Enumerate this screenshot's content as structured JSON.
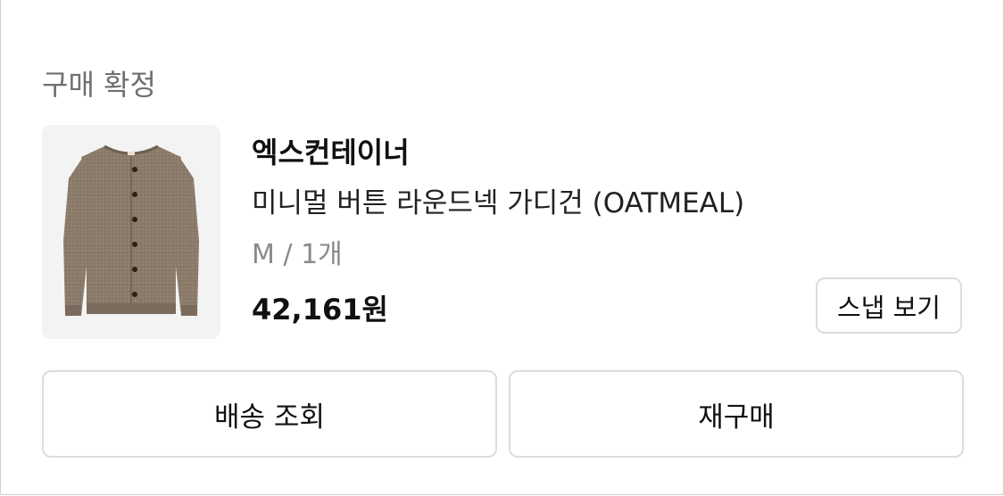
{
  "order_status": {
    "title": "구매 확정"
  },
  "product": {
    "image_icon": "cardigan-icon",
    "brand": "엑스컨테이너",
    "name": "미니멀 버튼 라운드넥 가디건 (OATMEAL)",
    "option": "M / 1개",
    "price": "42,161원"
  },
  "buttons": {
    "snap_view": "스냅 보기",
    "track_delivery": "배송 조회",
    "repurchase": "재구매"
  },
  "colors": {
    "product_color": "#8b7b6b",
    "thumbnail_bg": "#f3f3f3",
    "border": "#dcdcdc"
  }
}
